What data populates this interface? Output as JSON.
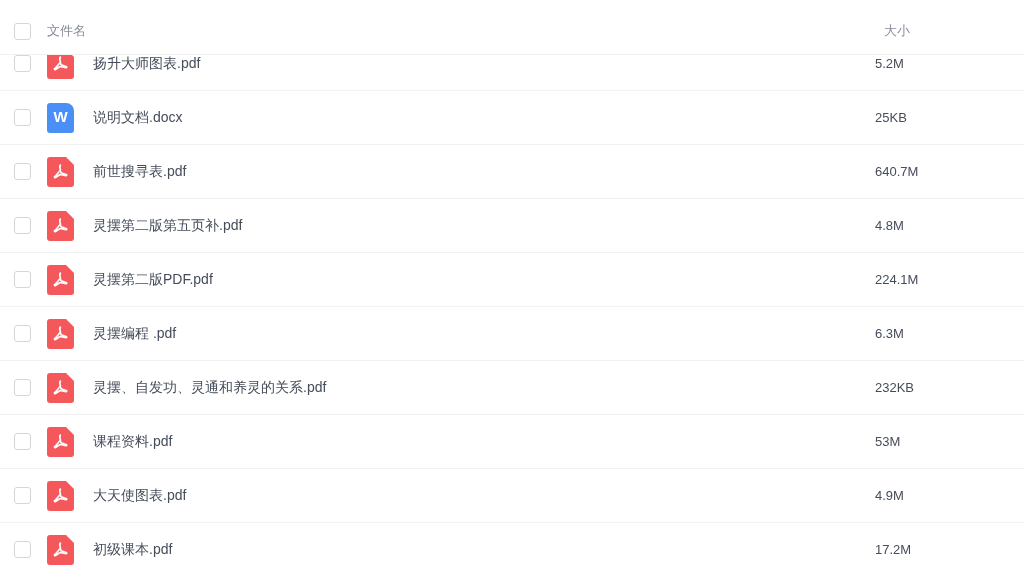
{
  "header": {
    "checked": false,
    "name_label": "文件名",
    "size_label": "大小"
  },
  "files": [
    {
      "kind": "pdf",
      "name": "扬升大师图表.pdf",
      "size": "5.2M",
      "checked": false
    },
    {
      "kind": "word",
      "name": "说明文档.docx",
      "size": "25KB",
      "checked": false,
      "icon_text": "W"
    },
    {
      "kind": "pdf",
      "name": "前世搜寻表.pdf",
      "size": "640.7M",
      "checked": false
    },
    {
      "kind": "pdf",
      "name": "灵摆第二版第五页补.pdf",
      "size": "4.8M",
      "checked": false
    },
    {
      "kind": "pdf",
      "name": "灵摆第二版PDF.pdf",
      "size": "224.1M",
      "checked": false
    },
    {
      "kind": "pdf",
      "name": "灵摆编程 .pdf",
      "size": "6.3M",
      "checked": false
    },
    {
      "kind": "pdf",
      "name": "灵摆、自发功、灵通和养灵的关系.pdf",
      "size": "232KB",
      "checked": false
    },
    {
      "kind": "pdf",
      "name": "课程资料.pdf",
      "size": "53M",
      "checked": false
    },
    {
      "kind": "pdf",
      "name": "大天使图表.pdf",
      "size": "4.9M",
      "checked": false
    },
    {
      "kind": "pdf",
      "name": "初级课本.pdf",
      "size": "17.2M",
      "checked": false
    }
  ]
}
